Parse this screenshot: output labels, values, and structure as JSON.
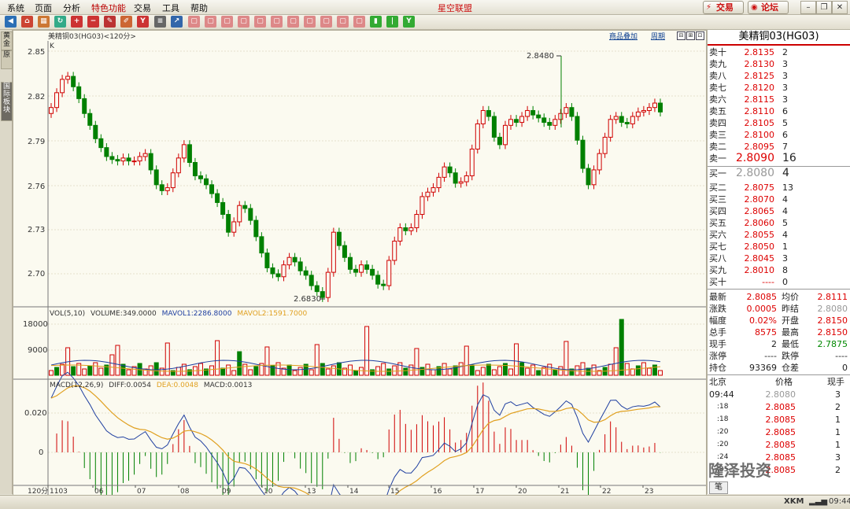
{
  "menu": {
    "items": [
      "系统",
      "页面",
      "分析",
      "特色功能",
      "交易",
      "工具",
      "帮助"
    ],
    "app_title": "星空联盟"
  },
  "top_buttons": {
    "trade": "交易",
    "forum": "论坛"
  },
  "left_tabs": [
    "黄金",
    "原",
    "国际板块"
  ],
  "chart": {
    "header": "美精铜03(HG03)<120分>",
    "links": {
      "overlay": "商品叠加",
      "period": "周期"
    },
    "k_label": "K",
    "price_ticks": [
      "2.85",
      "2.82",
      "2.79",
      "2.76",
      "2.73",
      "2.70"
    ],
    "high_label": "2.8480",
    "low_label": "2.6830",
    "volume_header": {
      "prefix": "VOL(5,10)",
      "volume": "VOLUME:349.0000",
      "mavol1": "MAVOL1:2286.8000",
      "mavol2": "MAVOL2:1591.7000"
    },
    "volume_ticks": [
      "18000",
      "9000"
    ],
    "macd_header": {
      "prefix": "MACD(12,26,9)",
      "diff": "DIFF:0.0054",
      "dea": "DEA:0.0048",
      "macd": "MACD:0.0013"
    },
    "macd_ticks": [
      "0.020",
      "0"
    ],
    "period_label": "120分",
    "x_labels": [
      "1103",
      "06",
      "07",
      "08",
      "09",
      "10",
      "13",
      "14",
      "15",
      "16",
      "17",
      "20",
      "21",
      "22",
      "23"
    ]
  },
  "quote": {
    "title": "美精铜03(HG03)",
    "asks": [
      {
        "label": "卖十",
        "price": "2.8135",
        "qty": "2"
      },
      {
        "label": "卖九",
        "price": "2.8130",
        "qty": "3"
      },
      {
        "label": "卖八",
        "price": "2.8125",
        "qty": "3"
      },
      {
        "label": "卖七",
        "price": "2.8120",
        "qty": "3"
      },
      {
        "label": "卖六",
        "price": "2.8115",
        "qty": "3"
      },
      {
        "label": "卖五",
        "price": "2.8110",
        "qty": "6"
      },
      {
        "label": "卖四",
        "price": "2.8105",
        "qty": "5"
      },
      {
        "label": "卖三",
        "price": "2.8100",
        "qty": "6"
      },
      {
        "label": "卖二",
        "price": "2.8095",
        "qty": "7"
      },
      {
        "label": "卖一",
        "price": "2.8090",
        "qty": "16"
      }
    ],
    "bids": [
      {
        "label": "买一",
        "price": "2.8080",
        "qty": "4"
      },
      {
        "label": "买二",
        "price": "2.8075",
        "qty": "13"
      },
      {
        "label": "买三",
        "price": "2.8070",
        "qty": "4"
      },
      {
        "label": "买四",
        "price": "2.8065",
        "qty": "4"
      },
      {
        "label": "买五",
        "price": "2.8060",
        "qty": "5"
      },
      {
        "label": "买六",
        "price": "2.8055",
        "qty": "4"
      },
      {
        "label": "买七",
        "price": "2.8050",
        "qty": "1"
      },
      {
        "label": "买八",
        "price": "2.8045",
        "qty": "3"
      },
      {
        "label": "买九",
        "price": "2.8010",
        "qty": "8"
      },
      {
        "label": "买十",
        "price": "----",
        "qty": "0"
      }
    ],
    "stats": [
      {
        "l1": "最新",
        "v1": "2.8085",
        "l2": "均价",
        "v2": "2.8111"
      },
      {
        "l1": "涨跌",
        "v1": "0.0005",
        "l2": "昨结",
        "v2": "2.8080"
      },
      {
        "l1": "幅度",
        "v1": "0.02%",
        "l2": "开盘",
        "v2": "2.8150"
      },
      {
        "l1": "总手",
        "v1": "8575",
        "l2": "最高",
        "v2": "2.8150"
      },
      {
        "l1": "现手",
        "v1": "2",
        "l2": "最低",
        "v2": "2.7875"
      },
      {
        "l1": "涨停",
        "v1": "----",
        "l2": "跌停",
        "v2": "----"
      },
      {
        "l1": "持仓",
        "v1": "93369",
        "l2": "仓差",
        "v2": "0"
      }
    ],
    "ticks_header": {
      "city": "北京",
      "price": "价格",
      "qty": "现手"
    },
    "ticks": [
      {
        "time": "09:44",
        "price": "2.8080",
        "qty": "3"
      },
      {
        "time": ":18",
        "price": "2.8085",
        "qty": "2"
      },
      {
        "time": ":18",
        "price": "2.8085",
        "qty": "1"
      },
      {
        "time": ":20",
        "price": "2.8085",
        "qty": "1"
      },
      {
        "time": ":20",
        "price": "2.8085",
        "qty": "1"
      },
      {
        "time": ":24",
        "price": "2.8085",
        "qty": "3"
      },
      {
        "time": ":35",
        "price": "2.8085",
        "qty": "2"
      }
    ],
    "bottom_tab": "笔"
  },
  "status": {
    "signal": "XKM",
    "time": "09:44"
  },
  "watermark": "隆泽投资",
  "colors": {
    "up": "#d00000",
    "down": "#008000",
    "ma_blue": "#1f3fa0",
    "ma_orange": "#e0a020"
  }
}
